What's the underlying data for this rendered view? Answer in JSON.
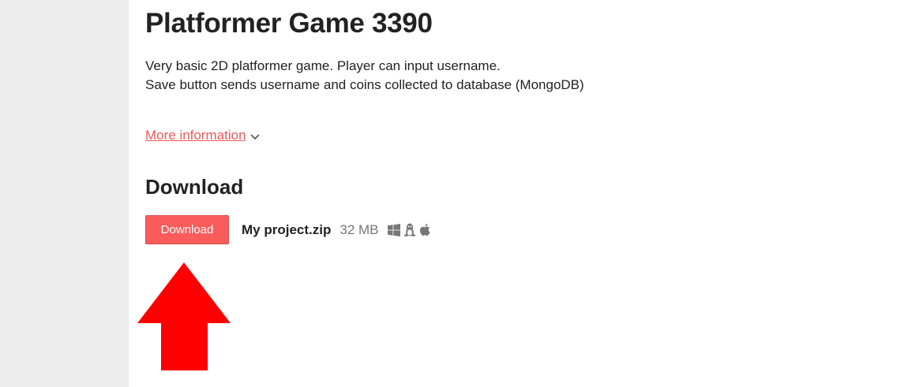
{
  "game": {
    "title": "Platformer Game 3390",
    "description_lines": [
      "Very basic 2D platformer game.  Player can input username.",
      "Save button sends username and coins collected to database (MongoDB)"
    ],
    "more_info_label": "More information"
  },
  "download_section": {
    "heading": "Download",
    "button_label": "Download",
    "file": {
      "name": "My project.zip",
      "size": "32 MB",
      "platform_icons": [
        "windows-icon",
        "linux-icon",
        "apple-icon"
      ]
    }
  },
  "colors": {
    "accent": "#fa5c5c",
    "link": "#ec5a5a",
    "arrow": "#ff0000",
    "gutter": "#ececec"
  }
}
